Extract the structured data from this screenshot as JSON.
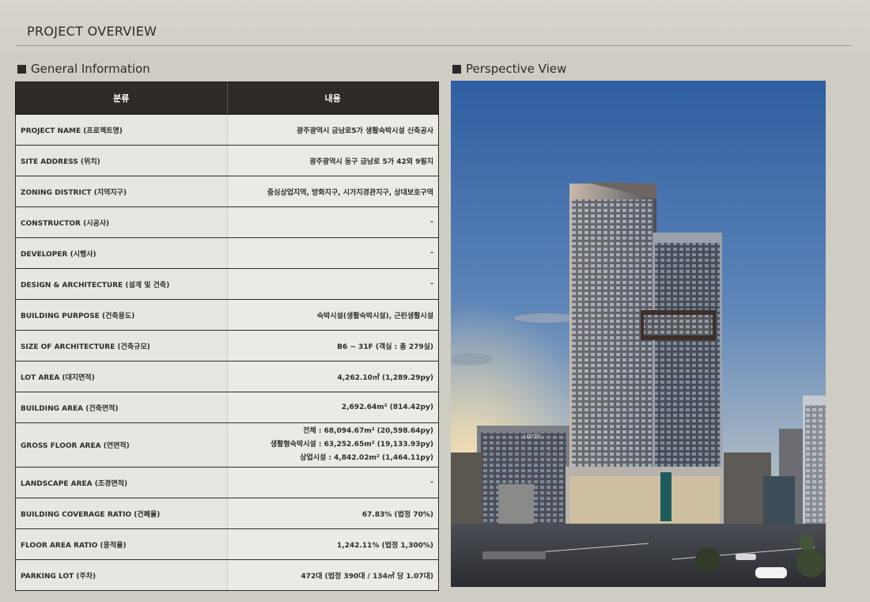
{
  "page": {
    "title": "PROJECT OVERVIEW"
  },
  "general": {
    "heading": "General Information",
    "header": {
      "category": "분류",
      "content": "내용"
    },
    "rows": [
      {
        "label": "PROJECT NAME (프로젝트명)",
        "value": "광주광역시 금남로5가 생활숙박시설 신축공사"
      },
      {
        "label": "SITE ADDRESS (위치)",
        "value": "광주광역시 동구 금남로 5가 42외 9필지"
      },
      {
        "label": "ZONING DISTRICT (지역지구)",
        "value": "중심상업지역, 방화지구, 시가지경관지구, 상대보호구역"
      },
      {
        "label": "CONSTRUCTOR (시공사)",
        "value": "-"
      },
      {
        "label": "DEVELOPER (시행사)",
        "value": "-"
      },
      {
        "label": "DESIGN & ARCHITECTURE (설계 및 건축)",
        "value": "-"
      },
      {
        "label": "BUILDING PURPOSE (건축용도)",
        "value": "숙박시설(생활숙박시설), 근린생활시설"
      },
      {
        "label": "SIZE OF ARCHITECTURE (건축규모)",
        "value": "B6 ~ 31F (객실 : 총 279실)"
      },
      {
        "label": "LOT AREA (대지면적)",
        "value": "4,262.10㎡ (1,289.29py)"
      },
      {
        "label": "BUILDING AREA (건축면적)",
        "value": "2,692.64m² (814.42py)"
      },
      {
        "label": "GROSS FLOOR AREA (연면적)",
        "value_lines": [
          "전체 : 68,094.67m² (20,598.64py)",
          "생활형숙박시설 : 63,252.65m² (19,133.93py)",
          "상업시설 : 4,842.02m² (1,464.11py)"
        ]
      },
      {
        "label": "LANDSCAPE AREA (조경면적)",
        "value": "-"
      },
      {
        "label": "BUILDING COVERAGE RATIO (건폐율)",
        "value": "67.83% (법정 70%)"
      },
      {
        "label": "FLOOR AREA RATIO (용적율)",
        "value": "1,242.11% (법정 1,300%)"
      },
      {
        "label": "PARKING LOT (주차)",
        "value": "472대 (법정 390대 / 134㎡ 당 1.07대)"
      }
    ]
  },
  "perspective": {
    "heading": "Perspective View",
    "sign_text": "LOTTE"
  },
  "colors": {
    "table_header": "#2f2b29",
    "background": "#cfcdc3",
    "cell_bg": "#e7e6e1"
  }
}
